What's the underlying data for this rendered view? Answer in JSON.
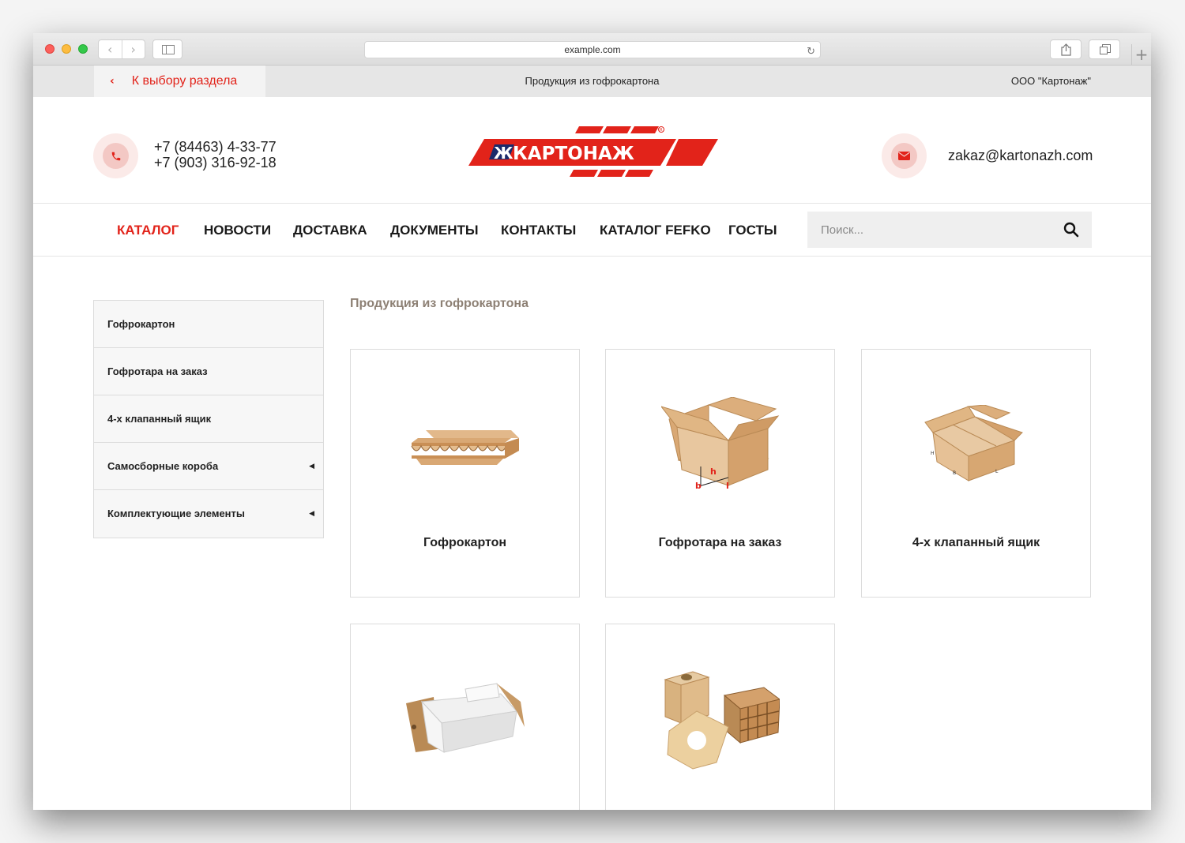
{
  "browser": {
    "url": "example.com",
    "back_icon": "chevron-left-icon",
    "forward_icon": "chevron-right-icon",
    "reload_icon": "reload-icon",
    "new_tab_label": "+"
  },
  "topbar": {
    "back_label": "К выбору раздела",
    "title": "Продукция из гофрокартона",
    "company": "ООО \"Картонаж\""
  },
  "header": {
    "phone1": "+7 (84463) 4-33-77",
    "phone2": "+7 (903) 316-92-18",
    "logo_text": "КАРТОНАЖ",
    "email": "zakaz@kartonazh.com"
  },
  "nav": {
    "items": [
      {
        "label": "КАТАЛОГ",
        "active": true
      },
      {
        "label": "НОВОСТИ"
      },
      {
        "label": "ДОСТАВКА"
      },
      {
        "label": "ДОКУМЕНТЫ"
      },
      {
        "label": "КОНТАКТЫ"
      },
      {
        "label": "КАТАЛОГ FEFKO"
      },
      {
        "label": "ГОСТЫ"
      }
    ],
    "search_placeholder": "Поиск..."
  },
  "sidebar": {
    "items": [
      {
        "label": "Гофрокартон",
        "has_submenu": false
      },
      {
        "label": "Гофротара на заказ",
        "has_submenu": false
      },
      {
        "label": "4-х клапанный ящик",
        "has_submenu": false
      },
      {
        "label": "Самосборные короба",
        "has_submenu": true
      },
      {
        "label": "Комплектующие элементы",
        "has_submenu": true
      }
    ]
  },
  "main": {
    "section_title": "Продукция из гофрокартона",
    "products": [
      {
        "label": "Гофрокартон",
        "image": "corrugated-sheet"
      },
      {
        "label": "Гофротара на заказ",
        "image": "open-box-dimensions"
      },
      {
        "label": "4-х клапанный ящик",
        "image": "four-flap-box"
      },
      {
        "label": "",
        "image": "self-assembly-box"
      },
      {
        "label": "",
        "image": "insert-components"
      }
    ],
    "dimension_labels": {
      "h": "h",
      "b": "b",
      "l": "l",
      "H": "H",
      "B": "B",
      "L": "L"
    }
  },
  "colors": {
    "accent": "#e2231a",
    "cardboard": "#d9a874",
    "topbar_bg": "#e6e6e6",
    "section_title": "#8d8074"
  }
}
